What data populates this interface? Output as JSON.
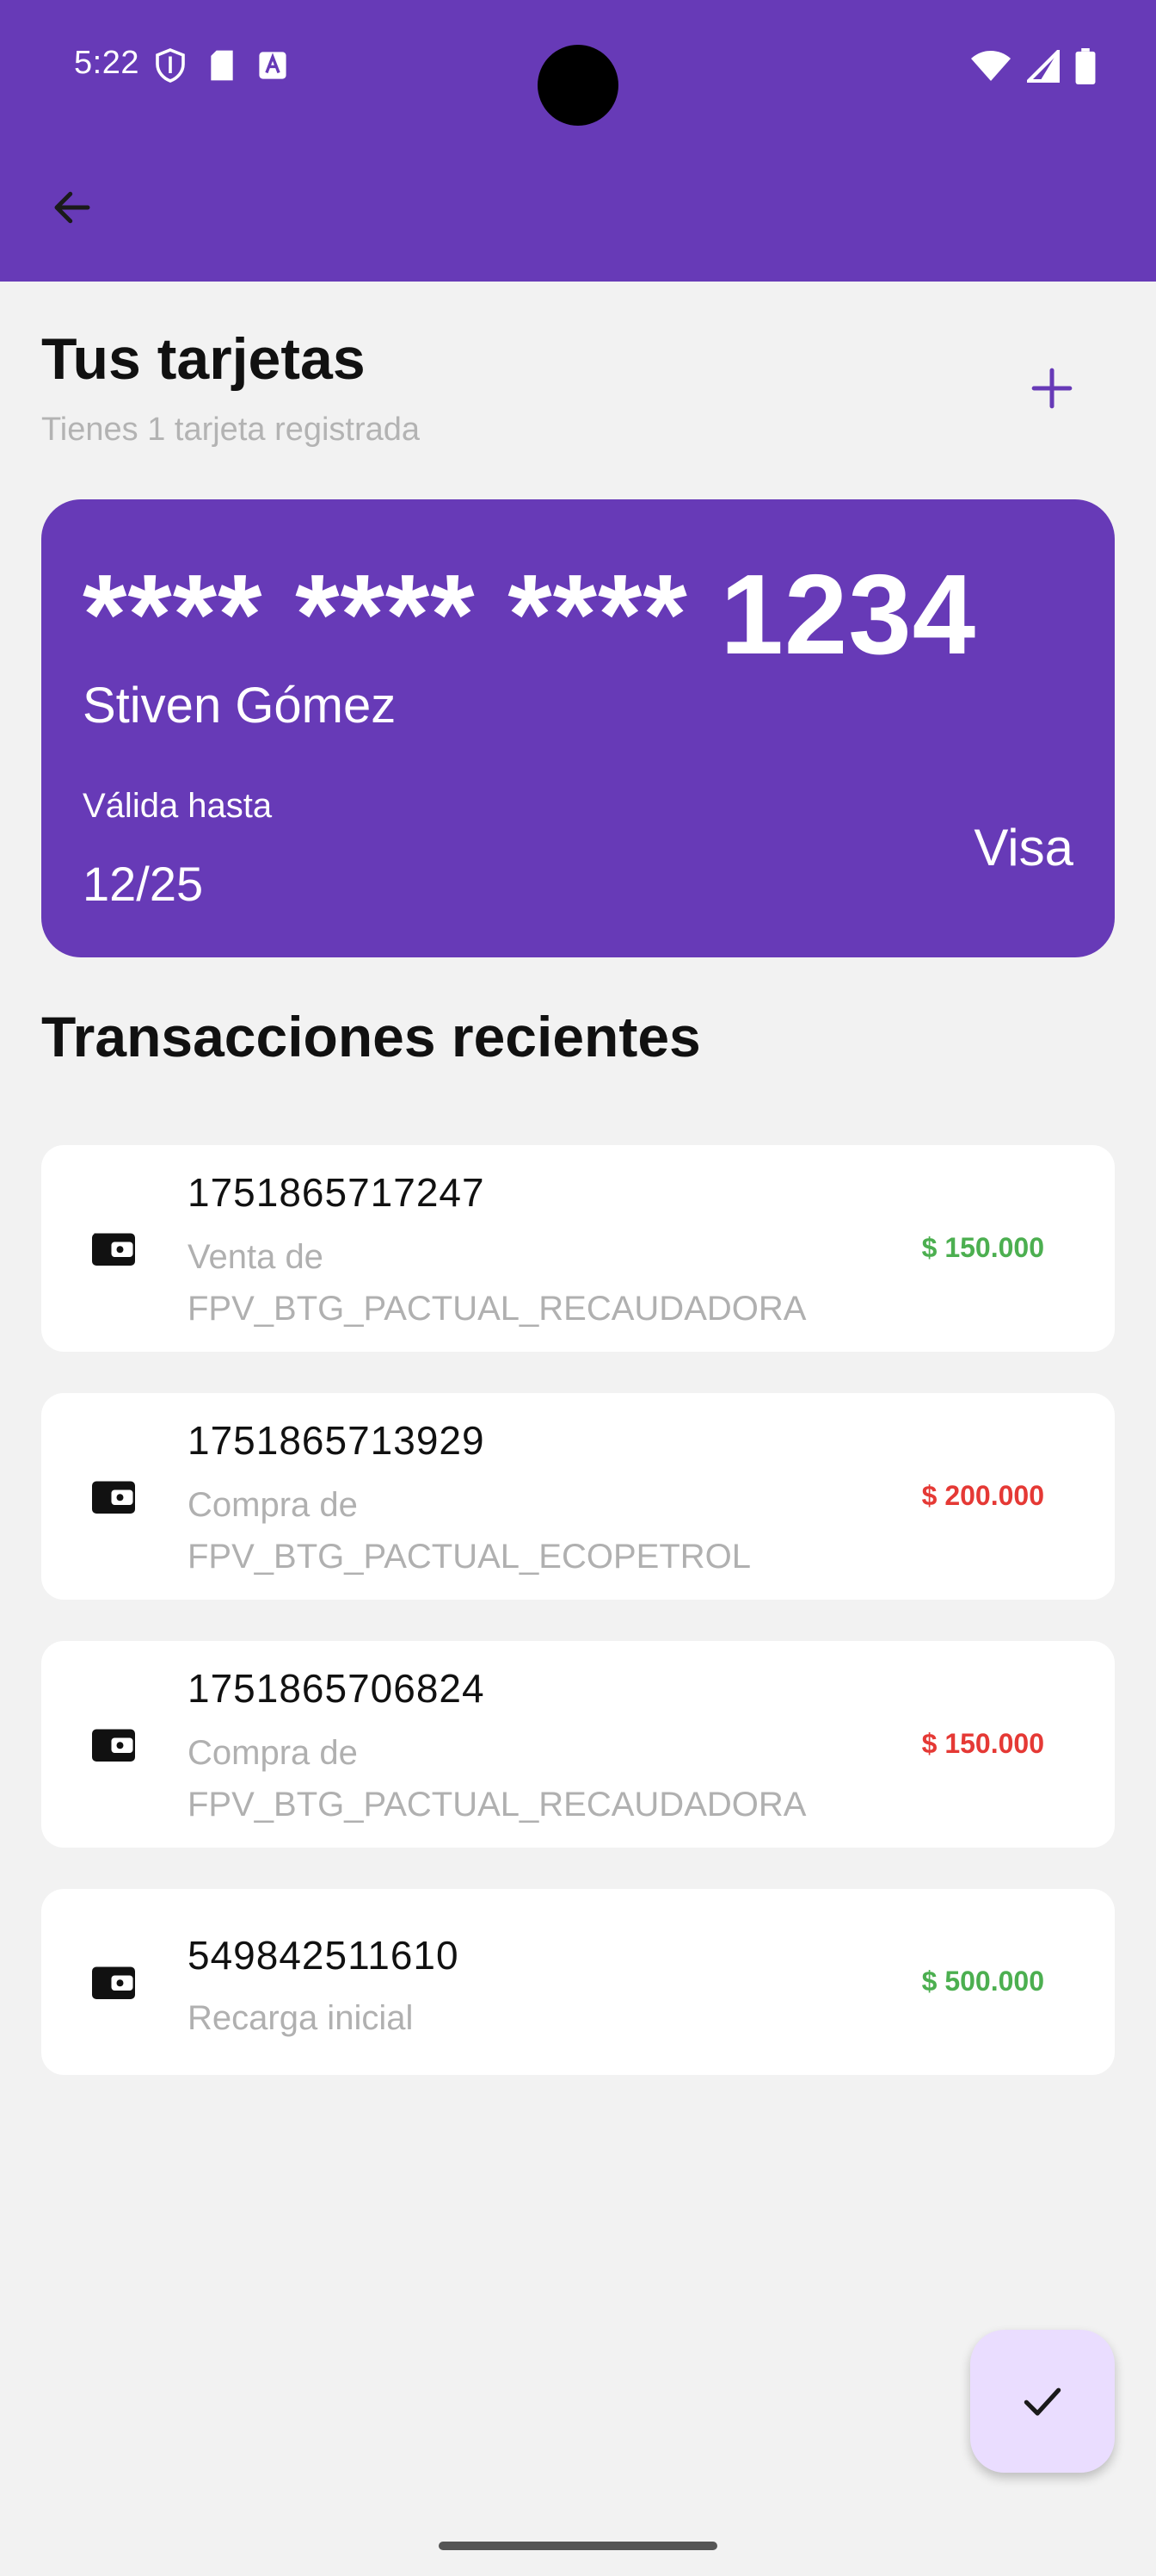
{
  "status_bar": {
    "time": "5:22"
  },
  "header": {
    "back_icon": "arrow-left-icon"
  },
  "cards_section": {
    "title": "Tus tarjetas",
    "subtitle": "Tienes 1 tarjeta registrada",
    "add_icon": "plus-icon"
  },
  "card": {
    "number": "**** **** **** 1234",
    "holder": "Stiven Gómez",
    "valid_label": "Válida hasta",
    "valid_value": "12/25",
    "brand": "Visa",
    "color": "#673ab7"
  },
  "transactions": {
    "title": "Transacciones recientes",
    "items": [
      {
        "id": "1751865717247",
        "desc_line1": "Venta de",
        "desc_line2": "FPV_BTG_PACTUAL_RECAUDADORA",
        "amount": "$ 150.000",
        "status": "positive"
      },
      {
        "id": "1751865713929",
        "desc_line1": "Compra de",
        "desc_line2": "FPV_BTG_PACTUAL_ECOPETROL",
        "amount": "$ 200.000",
        "status": "negative"
      },
      {
        "id": "1751865706824",
        "desc_line1": "Compra de",
        "desc_line2": "FPV_BTG_PACTUAL_RECAUDADORA",
        "amount": "$ 150.000",
        "status": "negative"
      },
      {
        "id": "549842511610",
        "desc_line1": "Recarga inicial",
        "desc_line2": "",
        "amount": "$ 500.000",
        "status": "positive"
      }
    ]
  },
  "colors": {
    "primary": "#673ab7",
    "positive": "#4caf50",
    "negative": "#e53935",
    "fab_bg": "#eaddff"
  },
  "fab": {
    "icon": "check-icon"
  }
}
